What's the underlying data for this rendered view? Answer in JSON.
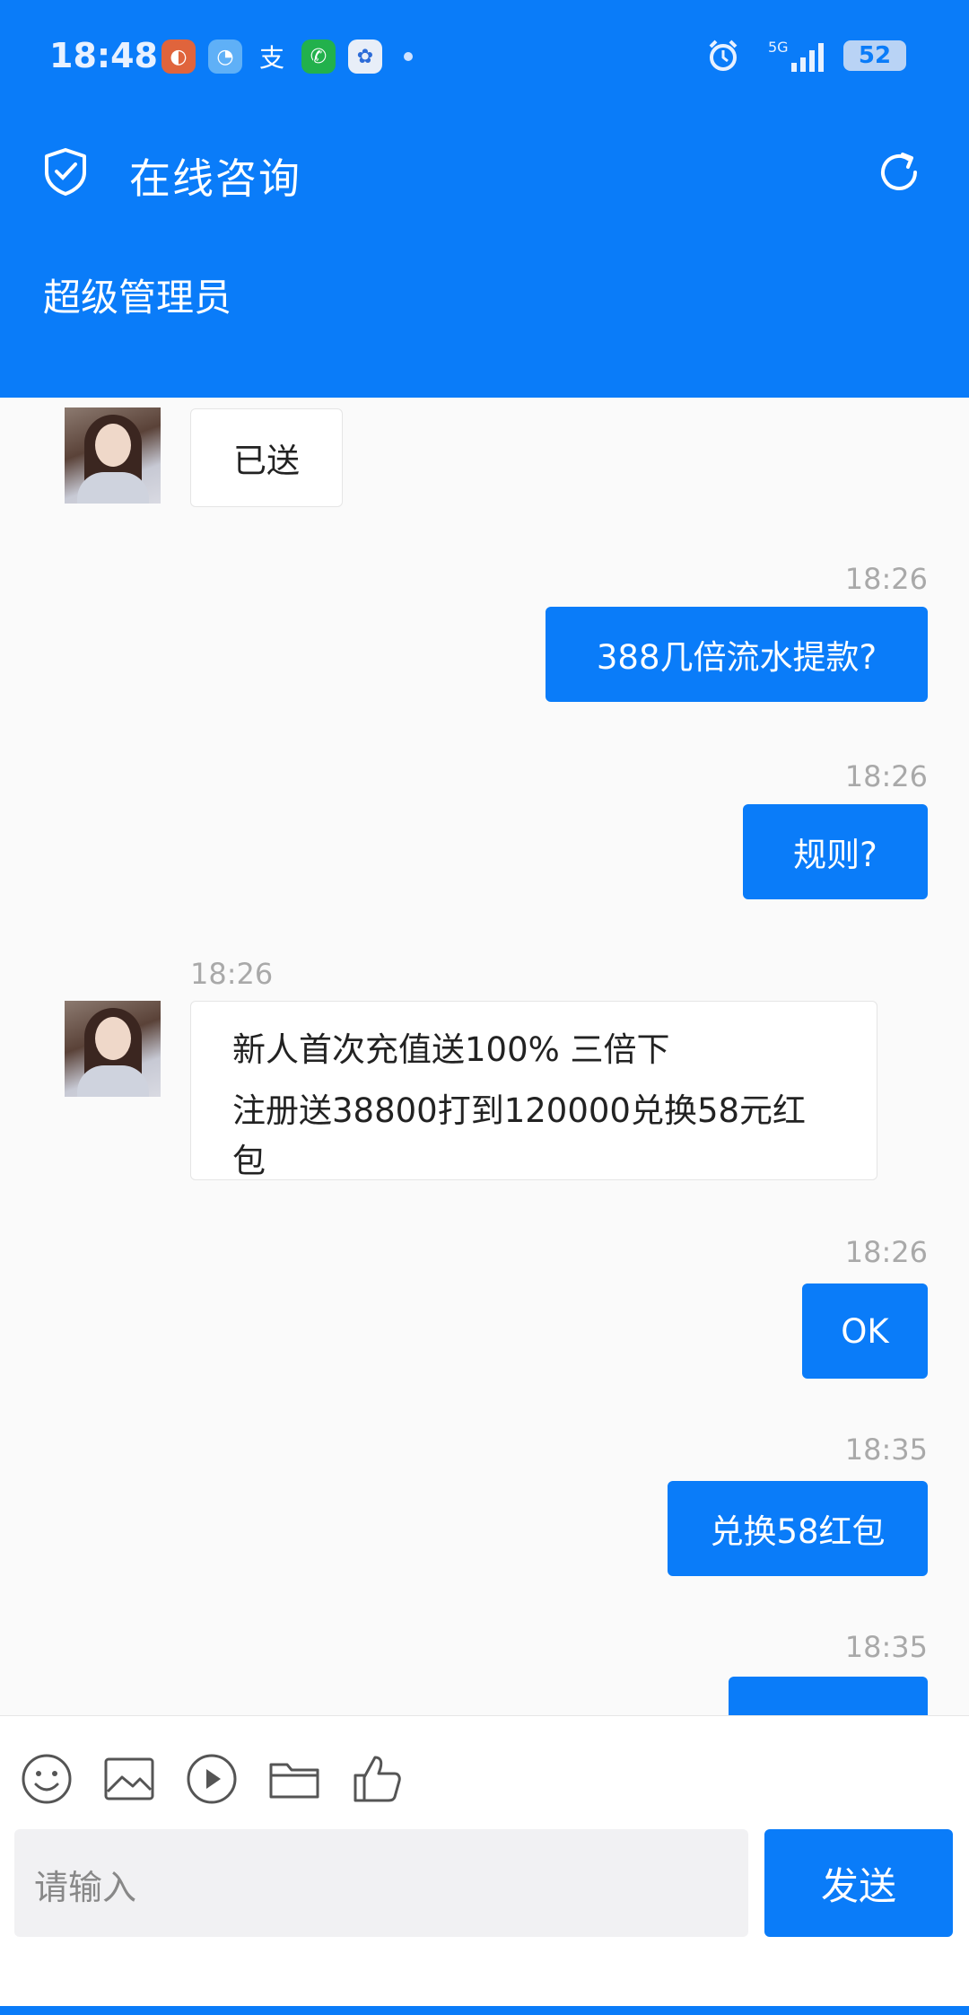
{
  "status_bar": {
    "time": "18:48",
    "network": "5G",
    "battery": "52"
  },
  "header": {
    "title": "在线咨询",
    "subtitle": "超级管理员"
  },
  "messages": {
    "m1": {
      "text": "已送"
    },
    "m2": {
      "time": "18:26",
      "text": "388几倍流水提款?"
    },
    "m3": {
      "time": "18:26",
      "text": "规则?"
    },
    "m4": {
      "time": "18:26",
      "line1": "新人首次充值送100% 三倍下",
      "line2": "注册送38800打到120000兑换58元红包"
    },
    "m5": {
      "time": "18:26",
      "text": "OK"
    },
    "m6": {
      "time": "18:35",
      "text": "兑换58红包"
    },
    "m7": {
      "time": "18:35",
      "text": ""
    }
  },
  "composer": {
    "placeholder": "请输入",
    "send_label": "发送"
  },
  "colors": {
    "brand": "#0a7cf9"
  }
}
